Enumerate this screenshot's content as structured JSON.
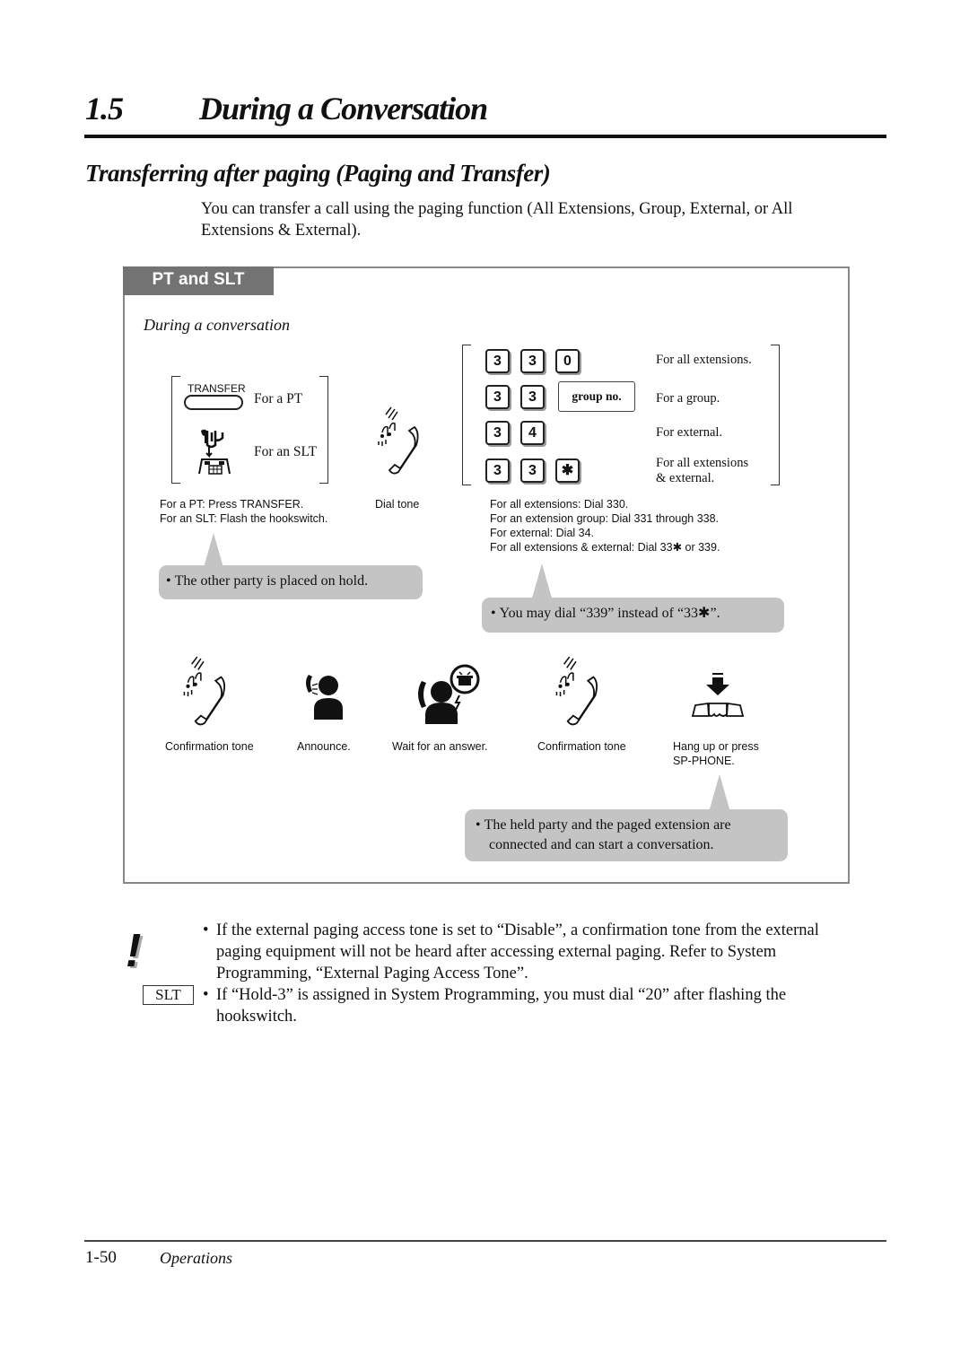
{
  "section": {
    "number": "1.5",
    "title": "During a Conversation"
  },
  "subsection_title": "Transferring after paging (Paging and Transfer)",
  "intro": "You can transfer a call using the paging function (All Extensions, Group, External, or All Extensions & External).",
  "procedure": {
    "tab_label": "PT and SLT",
    "context": "During a conversation",
    "step1": {
      "transfer_key_label": "TRANSFER",
      "for_pt": "For a PT",
      "for_slt": "For an SLT",
      "caption_line1": "For a PT: Press TRANSFER.",
      "caption_line2": "For an SLT: Flash the hookswitch."
    },
    "step2": {
      "caption": "Dial tone"
    },
    "step3": {
      "options": [
        {
          "keys": [
            "3",
            "3",
            "0"
          ],
          "label": "For all extensions."
        },
        {
          "keys": [
            "3",
            "3"
          ],
          "extra_key": "group no.",
          "label": "For a group."
        },
        {
          "keys": [
            "3",
            "4"
          ],
          "label": "For external."
        },
        {
          "keys": [
            "3",
            "3",
            "✱"
          ],
          "label_line1": "For all extensions",
          "label_line2": "& external."
        }
      ],
      "caption_lines": [
        "For all extensions: Dial 330.",
        "For an extension group: Dial 331 through 338.",
        "For external: Dial 34.",
        "For all extensions & external: Dial 33✱ or 339."
      ]
    },
    "bubbles": {
      "hold": "The other party is placed on hold.",
      "dial339": "You may dial “339” instead of “33✱”.",
      "connected_line1": "The held party and the paged extension are",
      "connected_line2": "connected and can start a conversation."
    },
    "bottom_steps": [
      {
        "icon": "confirmation-tone-icon",
        "caption": "Confirmation tone"
      },
      {
        "icon": "announce-icon",
        "caption": "Announce."
      },
      {
        "icon": "wait-answer-icon",
        "caption": "Wait for an answer."
      },
      {
        "icon": "confirmation-tone-icon",
        "caption": "Confirmation tone"
      },
      {
        "icon": "hang-up-icon",
        "caption_line1": "Hang up or press",
        "caption_line2": "SP-PHONE."
      }
    ]
  },
  "notes": {
    "slt_label": "SLT",
    "note1_line1": "If the external paging access tone is set to “Disable”, a confirmation tone from the external",
    "note1_line2": "paging equipment will not be heard after accessing external paging. Refer to System",
    "note1_line3": "Programming, “External Paging Access Tone”.",
    "note2_line1": "If “Hold-3” is assigned in System Programming, you must dial “20” after flashing the",
    "note2_line2": "hookswitch."
  },
  "footer": {
    "page_number": "1-50",
    "section": "Operations"
  }
}
